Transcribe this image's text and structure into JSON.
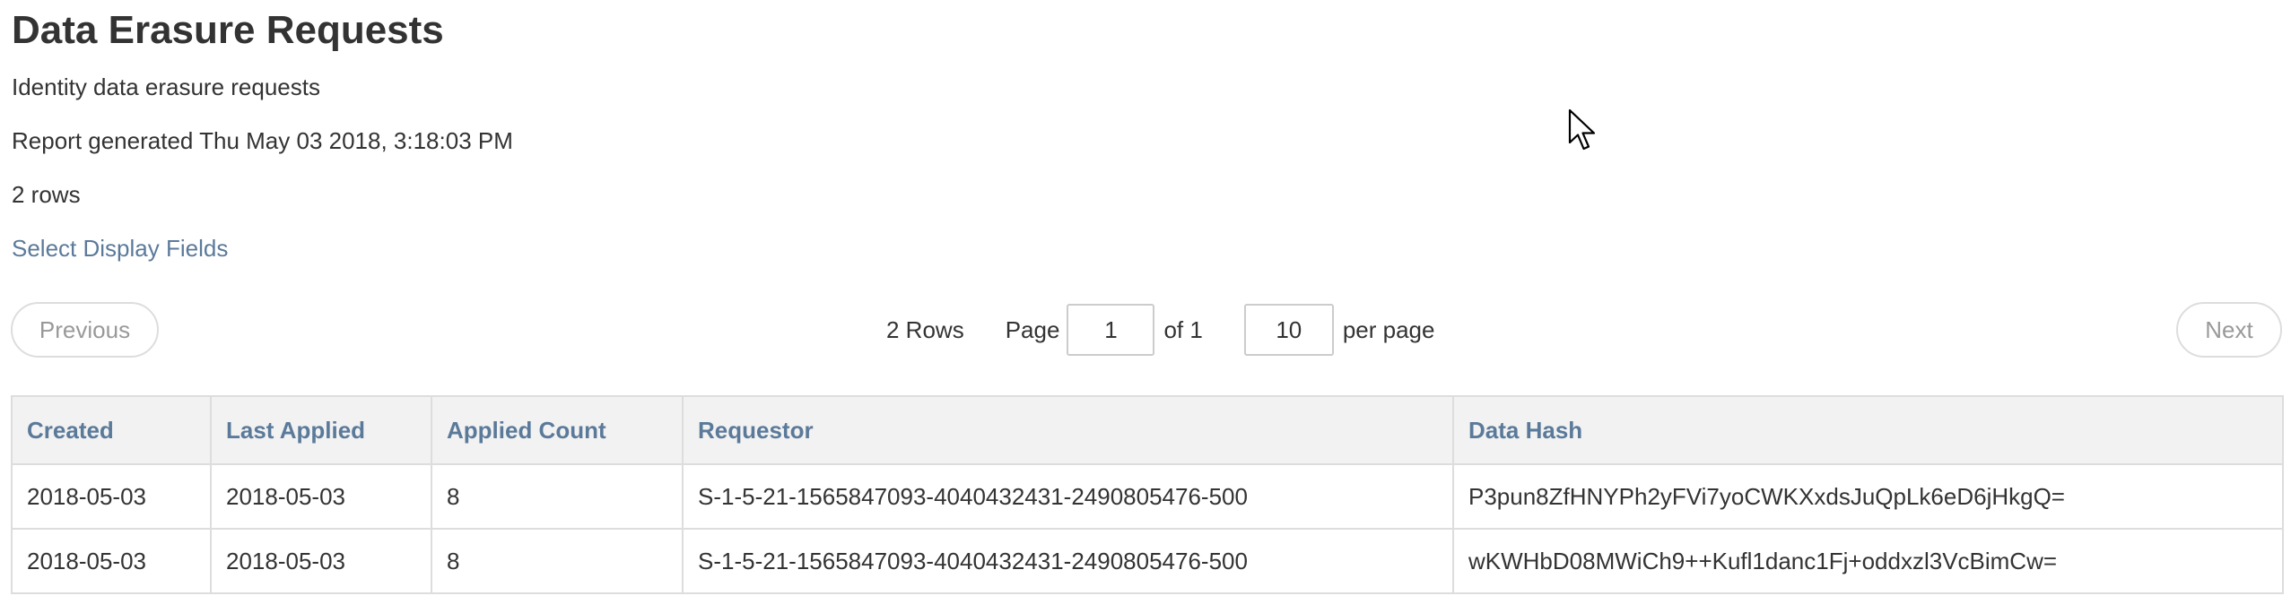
{
  "page": {
    "title": "Data Erasure Requests",
    "subtitle": "Identity data erasure requests",
    "generated": "Report generated Thu May 03 2018, 3:18:03 PM",
    "row_count": "2 rows",
    "select_fields_link": "Select Display Fields"
  },
  "pager": {
    "previous_label": "Previous",
    "next_label": "Next",
    "rows_label": "2 Rows",
    "page_label": "Page",
    "page_value": "1",
    "of_label": "of 1",
    "per_page_value": "10",
    "per_page_label": "per page"
  },
  "table": {
    "columns": [
      "Created",
      "Last Applied",
      "Applied Count",
      "Requestor",
      "Data Hash"
    ],
    "rows": [
      [
        "2018-05-03",
        "2018-05-03",
        "8",
        "S-1-5-21-1565847093-4040432431-2490805476-500",
        "P3pun8ZfHNYPh2yFVi7yoCWKXxdsJuQpLk6eD6jHkgQ="
      ],
      [
        "2018-05-03",
        "2018-05-03",
        "8",
        "S-1-5-21-1565847093-4040432431-2490805476-500",
        "wKWHbD08MWiCh9++Kufl1danc1Fj+oddxzl3VcBimCw="
      ]
    ]
  },
  "icons": {
    "cursor": "mouse-pointer-icon"
  }
}
